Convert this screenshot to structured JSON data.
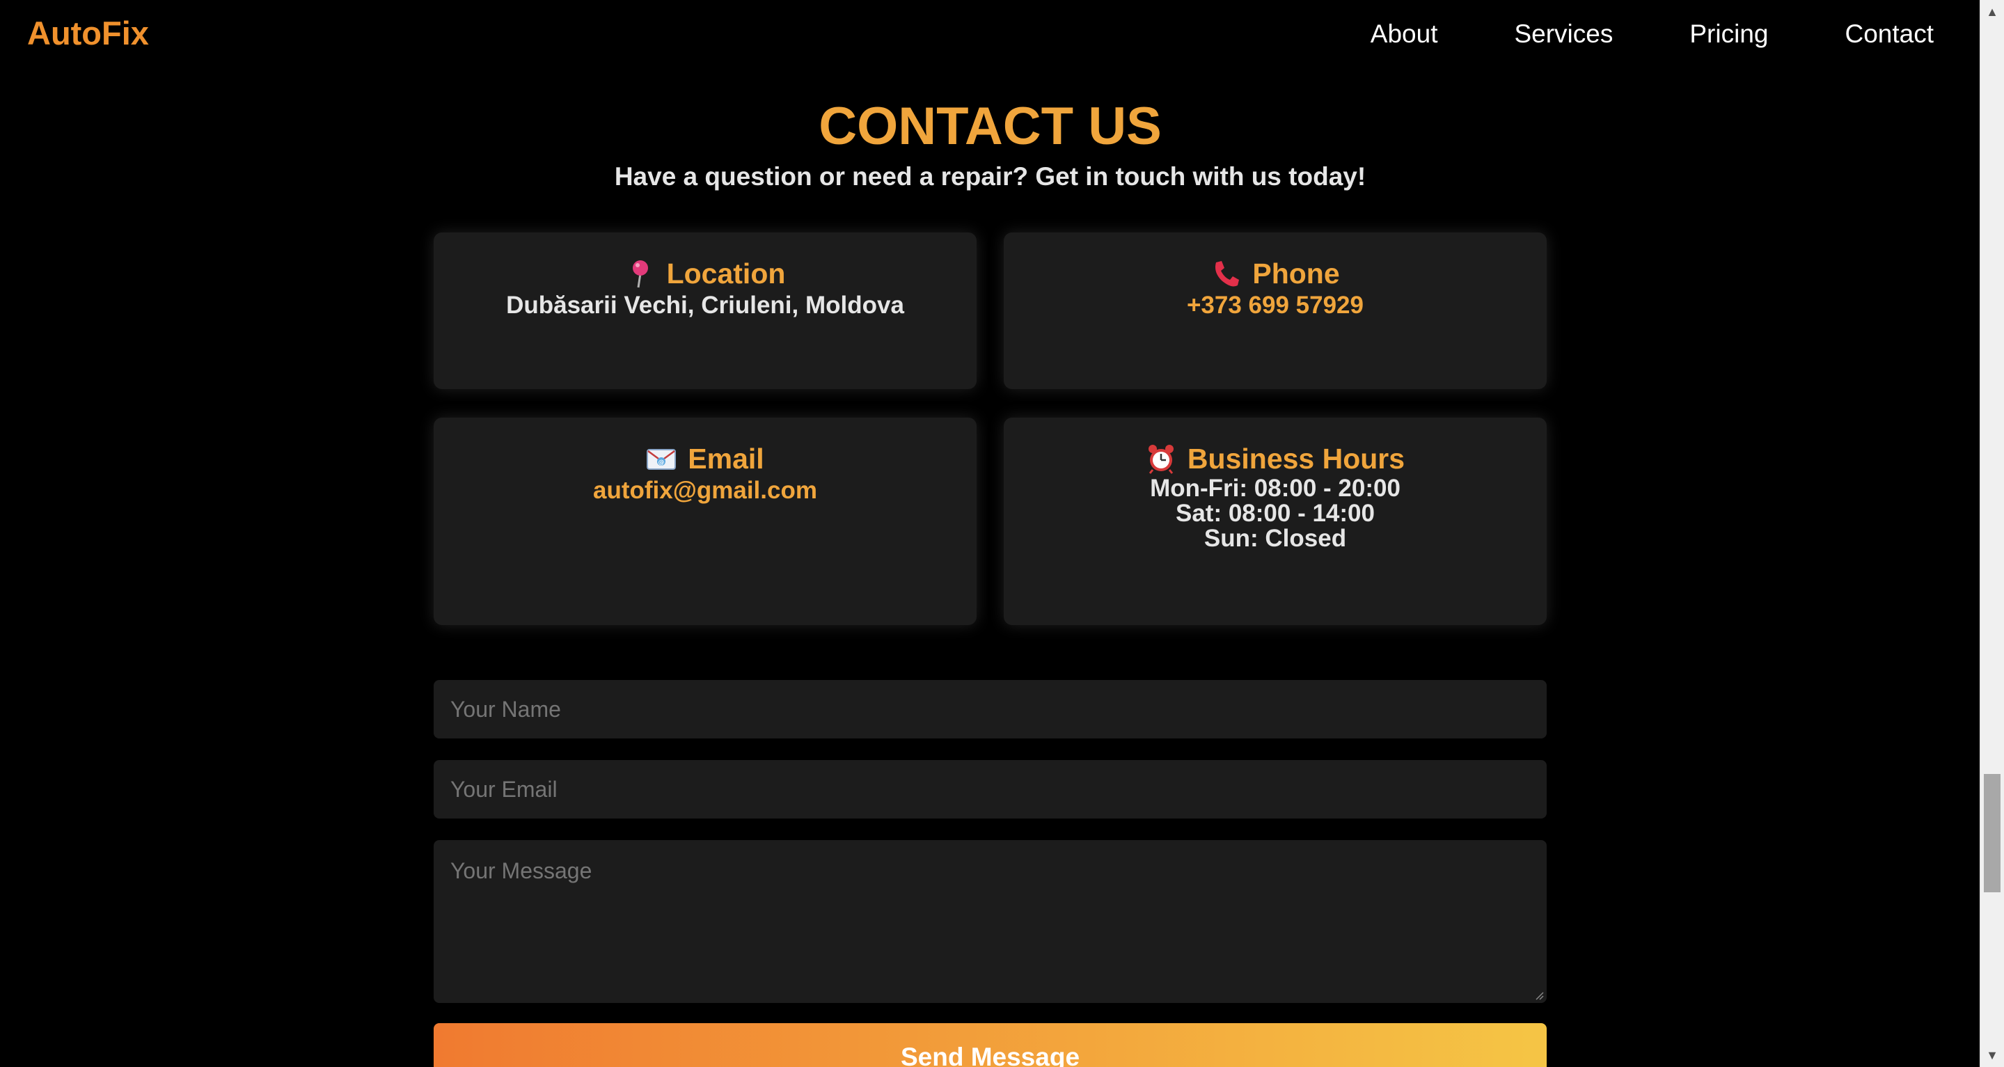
{
  "header": {
    "brand": "AutoFix",
    "nav": [
      "About",
      "Services",
      "Pricing",
      "Contact"
    ]
  },
  "hero": {
    "title": "CONTACT US",
    "subtitle": "Have a question or need a repair? Get in touch with us today!"
  },
  "cards": {
    "location": {
      "icon": "pin-icon",
      "heading": "Location",
      "value": "Dubăsarii Vechi, Criuleni, Moldova"
    },
    "phone": {
      "icon": "phone-icon",
      "heading": "Phone",
      "value": "+373 699 57929"
    },
    "email": {
      "icon": "envelope-icon",
      "heading": "Email",
      "value": "autofix@gmail.com"
    },
    "hours": {
      "icon": "alarm-clock-icon",
      "heading": "Business Hours",
      "lines": [
        "Mon-Fri: 08:00 - 20:00",
        "Sat: 08:00 - 14:00",
        "Sun: Closed"
      ]
    }
  },
  "form": {
    "name_placeholder": "Your Name",
    "email_placeholder": "Your Email",
    "message_placeholder": "Your Message",
    "submit_label": "Send Message"
  },
  "colors": {
    "accent": "#f0a53c",
    "brand": "#f0912d",
    "card_bg": "#1c1c1c",
    "button_gradient_start": "#f07a30",
    "button_gradient_end": "#f5c545"
  }
}
